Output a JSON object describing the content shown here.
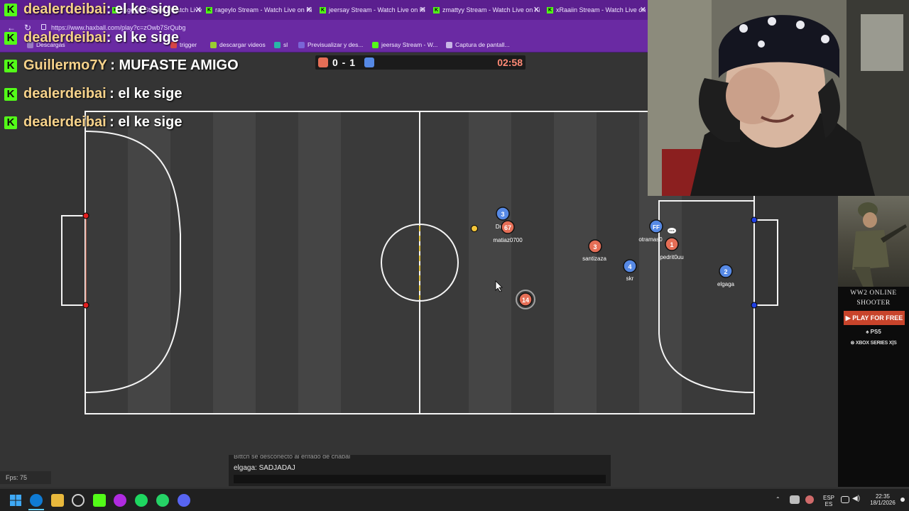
{
  "browser": {
    "tabs": [
      {
        "label": "rageylo Stream - Watch Live on Ki",
        "close": "✕"
      },
      {
        "label": "jeersay Stream - Watch Live on Ki",
        "close": "✕"
      },
      {
        "label": "zmattyy Stream - Watch Live on Ki",
        "close": "✕"
      },
      {
        "label": "xRaaiin Stream - Watch Live on Ki",
        "close": "✕"
      }
    ],
    "url": "https://www.haxball.com/play?c=zOwb7SrQubg",
    "bookmarks": [
      {
        "label": "Descargas"
      },
      {
        "label": "trigger"
      },
      {
        "label": "descargar videos"
      },
      {
        "label": "sl"
      },
      {
        "label": "Previsualizar y des..."
      },
      {
        "label": "jeersay Stream - W..."
      },
      {
        "label": "Captura de pantall..."
      }
    ]
  },
  "chat_overlay": [
    {
      "user": "dealerdeibai",
      "message": ": el ke sige"
    },
    {
      "user": "dealerdeibai",
      "message": ": el ke sige"
    },
    {
      "user": "Guillermo7Y",
      "message": ": MUFASTE AMIGO"
    },
    {
      "user": "dealerdeibai",
      "message": ": el ke sige"
    },
    {
      "user": "dealerdeibai",
      "message": ": el ke sige"
    }
  ],
  "kick_badge": "K",
  "scoreboard": {
    "score": "0 - 1",
    "time": "02:58"
  },
  "players": [
    {
      "team": "blue",
      "number": "3",
      "name": "Dr"
    },
    {
      "team": "red",
      "number": "67",
      "name": "matiaz0700"
    },
    {
      "team": "red",
      "number": "3",
      "name": "santizaza"
    },
    {
      "team": "blue",
      "number": "FF",
      "name": "otramas0"
    },
    {
      "team": "red",
      "number": "1",
      "name": "pedrit0uu"
    },
    {
      "team": "blue",
      "number": "4",
      "name": "skr"
    },
    {
      "team": "blue",
      "number": "2",
      "name": "elgaga"
    },
    {
      "team": "red",
      "number": "14",
      "name": ""
    }
  ],
  "ad": {
    "title_line1": "WW2 ONLINE",
    "title_line2": "SHOOTER",
    "button": "▶ PLAY FOR FREE",
    "platform1": "PS5",
    "platform2": "XBOX SERIES X|S"
  },
  "game_chat": {
    "previous": "Bittch se desconectó al enfado de chabal",
    "last_line": "elgaga: SADJADAJ"
  },
  "fps": "Fps: 75",
  "taskbar": {
    "lang_top": "ESP",
    "lang_bottom": "ES",
    "time": "22:35",
    "date": "18/1/2026"
  },
  "colors": {
    "red_team": "#e56e56",
    "blue_team": "#5689e5",
    "browser_purple": "#6a2aa3",
    "kick_green": "#53fc18"
  }
}
